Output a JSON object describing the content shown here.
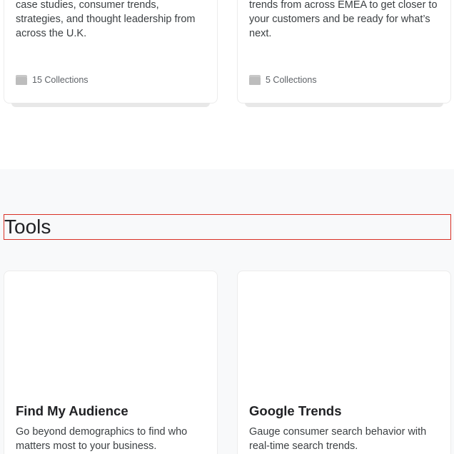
{
  "collections": [
    {
      "description": "case studies, consumer trends, strategies, and thought leadership from across the U.K.",
      "count_label": "15 Collections",
      "icon": "folder-icon"
    },
    {
      "description": "trends from across EMEA to get closer to your customers and be ready for what’s next.",
      "count_label": "5 Collections",
      "icon": "folder-icon"
    }
  ],
  "tools": {
    "heading": "Tools",
    "items": [
      {
        "title": "Find My Audience",
        "description": "Go beyond demographics to find who matters most to your business."
      },
      {
        "title": "Google Trends",
        "description": "Gauge consumer search behavior with real-time search trends."
      }
    ]
  },
  "colors": {
    "highlight_border": "#d93025",
    "section_background": "#f8f9fa",
    "card_border": "#ececec"
  }
}
